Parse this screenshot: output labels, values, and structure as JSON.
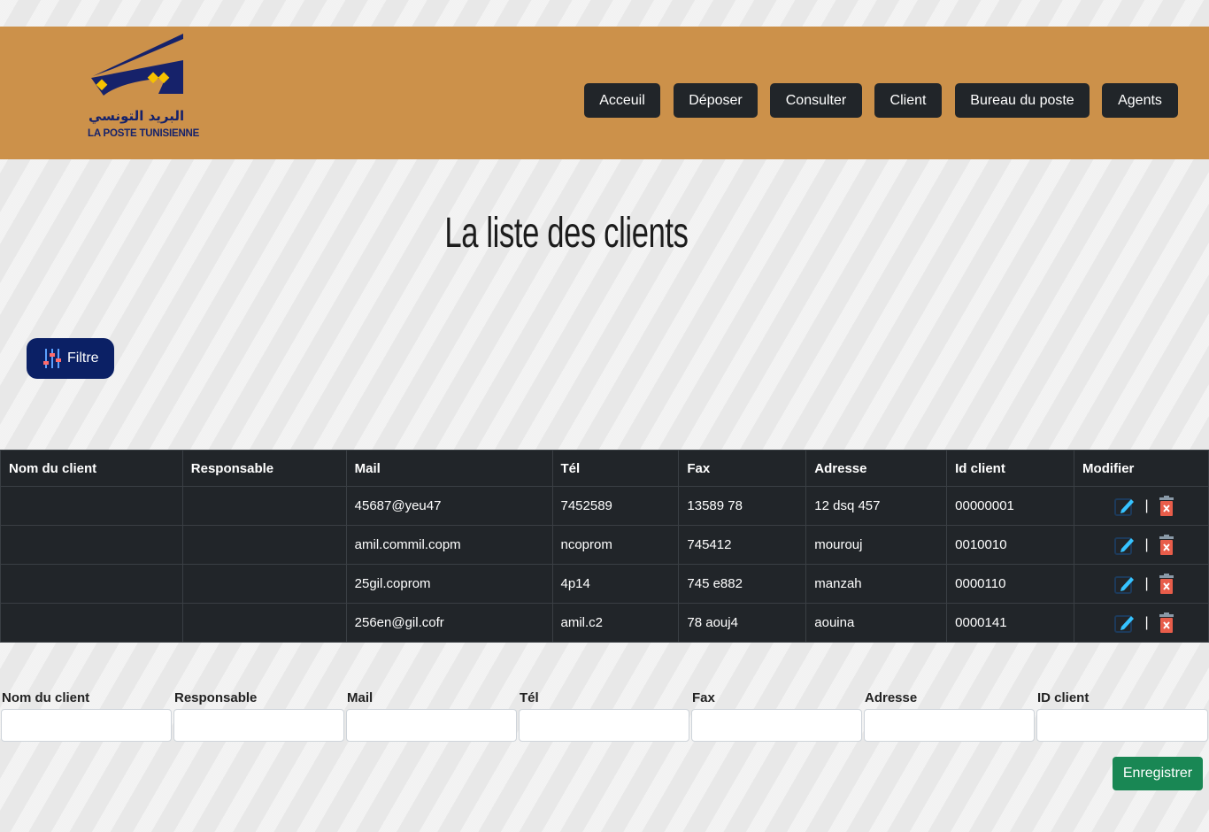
{
  "brand": {
    "arabic_name": "البريد التونسي",
    "french_name": "LA POSTE TUNISIENNE",
    "colors": {
      "header": "#cc914a",
      "logo_blue": "#16226a",
      "logo_yellow": "#f6c200"
    }
  },
  "nav": {
    "items": [
      "Acceuil",
      "Déposer",
      "Consulter",
      "Client",
      "Bureau du poste",
      "Agents"
    ]
  },
  "page": {
    "title": "La liste des clients"
  },
  "filter": {
    "label": "Filtre",
    "icon": "sliders-icon"
  },
  "table": {
    "columns": [
      "Nom du client",
      "Responsable",
      "Mail",
      "Tél",
      "Fax",
      "Adresse",
      "Id client",
      "Modifier"
    ],
    "rows": [
      {
        "nom": "",
        "responsable": "",
        "mail": "45687@yeu47",
        "tel": "7452589",
        "fax": "13589 78",
        "adresse": "12 dsq 457",
        "id": "00000001"
      },
      {
        "nom": "",
        "responsable": "",
        "mail": "amil.commil.copm",
        "tel": "ncoprom",
        "fax": "745412",
        "adresse": "mourouj",
        "id": "0010010"
      },
      {
        "nom": "",
        "responsable": "",
        "mail": "25gil.coprom",
        "tel": "4p14",
        "fax": "745 e882",
        "adresse": "manzah",
        "id": "0000110"
      },
      {
        "nom": "",
        "responsable": "",
        "mail": "256en@gil.cofr",
        "tel": "amil.c2",
        "fax": "78 aouj4",
        "adresse": "aouina",
        "id": "0000141"
      }
    ],
    "action_separator": "|",
    "action_icons": [
      "pencil-icon",
      "trash-icon"
    ]
  },
  "form": {
    "labels": [
      "Nom du client",
      "Responsable",
      "Mail",
      "Tél",
      "Fax",
      "Adresse",
      "ID client"
    ],
    "save_label": "Enregistrer"
  }
}
